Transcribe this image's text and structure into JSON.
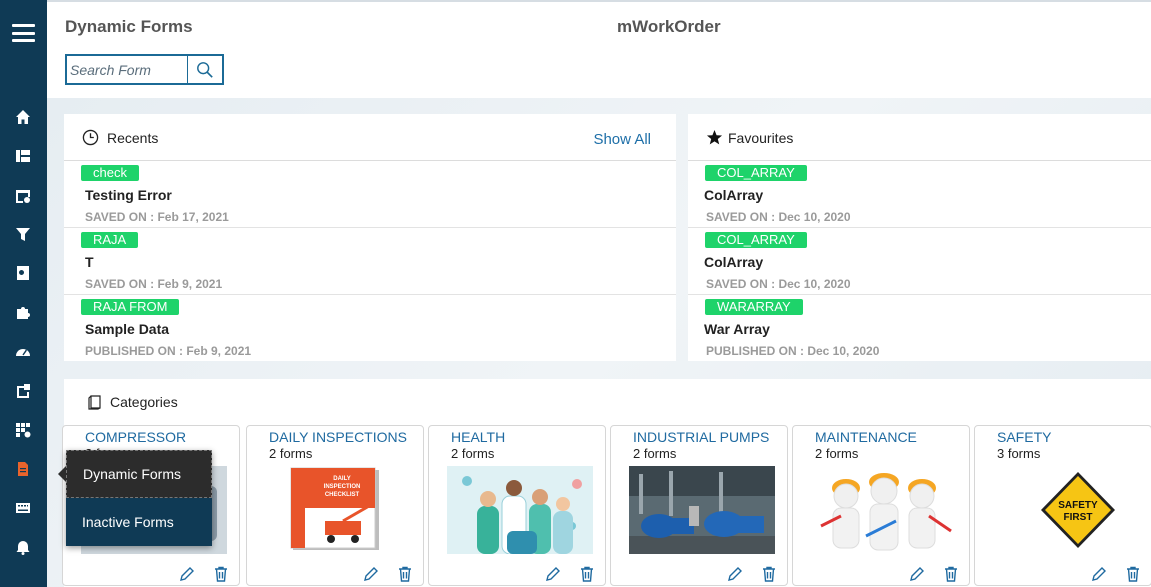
{
  "header": {
    "app_title": "Dynamic Forms",
    "center_title": "mWorkOrder",
    "search_placeholder": "Search Form"
  },
  "sidebar": {
    "icons": [
      "home-icon",
      "dashboard-icon",
      "settings-window-icon",
      "filter-icon",
      "search-doc-icon",
      "puzzle-icon",
      "speedometer-icon",
      "clipboard-icon",
      "grid-settings-icon",
      "document-icon",
      "keyboard-icon",
      "alarm-icon"
    ],
    "active": "document-icon"
  },
  "recents": {
    "title": "Recents",
    "show_all": "Show All",
    "items": [
      {
        "tag": "check",
        "title": "Testing Error",
        "saved": "SAVED ON : Feb 17, 2021"
      },
      {
        "tag": "RAJA",
        "title": "T",
        "saved": "SAVED ON : Feb 9, 2021"
      },
      {
        "tag": "RAJA FROM",
        "title": "Sample Data",
        "saved": "PUBLISHED ON : Feb 9, 2021"
      }
    ]
  },
  "favourites": {
    "title": "Favourites",
    "items": [
      {
        "tag": "COL_ARRAY",
        "title": "ColArray",
        "saved": "SAVED ON : Dec 10, 2020"
      },
      {
        "tag": "COL_ARRAY",
        "title": "ColArray",
        "saved": "SAVED ON : Dec 10, 2020"
      },
      {
        "tag": "WARARRAY",
        "title": "War Array",
        "saved": "PUBLISHED ON : Dec 10, 2020"
      }
    ]
  },
  "categories": {
    "title": "Categories",
    "cards": [
      {
        "name": "COMPRESSOR",
        "count": "2 forms"
      },
      {
        "name": "DAILY INSPECTIONS",
        "count": "2 forms"
      },
      {
        "name": "HEALTH",
        "count": "2 forms"
      },
      {
        "name": "INDUSTRIAL PUMPS",
        "count": "2 forms"
      },
      {
        "name": "MAINTENANCE",
        "count": "2 forms"
      },
      {
        "name": "SAFETY",
        "count": "3 forms"
      }
    ]
  },
  "images": {
    "checklist_line1": "DAILY",
    "checklist_line2": "INSPECTION",
    "checklist_line3": "CHECKLIST",
    "safety_line1": "SAFETY",
    "safety_line2": "FIRST"
  },
  "popup": {
    "items": [
      "Dynamic Forms",
      "Inactive Forms"
    ]
  },
  "colors": {
    "sidebar": "#0f3a55",
    "tag": "#1ed36a",
    "link": "#1e6fa8",
    "active_icon": "#e8642c"
  }
}
